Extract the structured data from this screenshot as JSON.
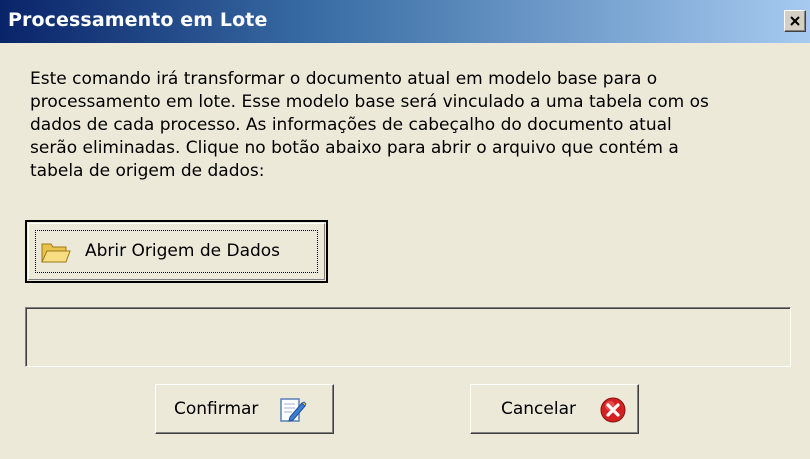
{
  "window": {
    "title": "Processamento em Lote",
    "close_icon": "close-icon"
  },
  "description": "Este comando irá transformar o documento atual em modelo base para o\nprocessamento em lote. Esse modelo base será vinculado a uma tabela com os\ndados de cada processo. As informações de cabeçalho do documento atual\nserão eliminadas. Clique no botão abaixo para abrir o arquivo que contém a\ntabela de origem de dados:",
  "open_source": {
    "label": "Abrir Origem de Dados",
    "icon": "folder-icon"
  },
  "path_field": {
    "value": ""
  },
  "buttons": {
    "confirm": {
      "label": "Confirmar",
      "icon": "edit-document-icon"
    },
    "cancel": {
      "label": "Cancelar",
      "icon": "cancel-icon"
    }
  },
  "colors": {
    "titlebar_start": "#0a246a",
    "titlebar_end": "#a6caf0",
    "dialog_bg": "#ece9d8",
    "cancel_red": "#d42020"
  }
}
